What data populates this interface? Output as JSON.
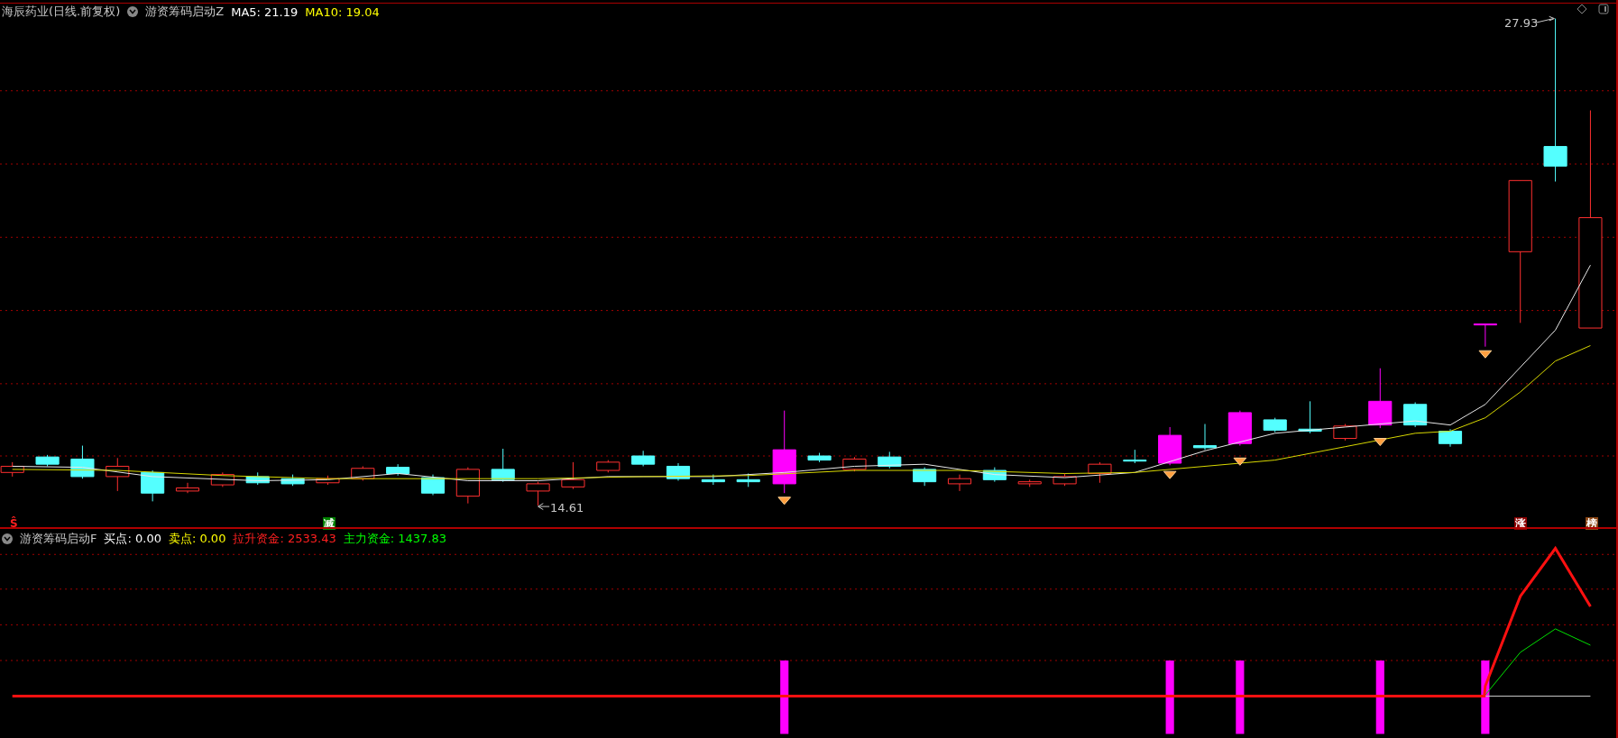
{
  "main_panel": {
    "legend": [
      {
        "text": "海辰药业(日线.前复权)",
        "color": "#c8c8c8"
      },
      {
        "text": "游资筹码启动Z",
        "color": "#c8c8c8"
      },
      {
        "text": "MA5: 21.19",
        "color": "#ffffff"
      },
      {
        "text": "MA10: 19.04",
        "color": "#ffff00"
      }
    ],
    "price_labels": [
      "27.93",
      "14.61"
    ],
    "tags": [
      {
        "text": "Ŝ",
        "color": "#ff2020",
        "kind": "plain"
      },
      {
        "text": "减",
        "color": "#008000",
        "kind": "boxed"
      },
      {
        "text": "涨",
        "color": "#8b0000",
        "kind": "boxed"
      },
      {
        "text": "榜",
        "color": "#8b4513",
        "kind": "boxed"
      }
    ]
  },
  "sub_panel": {
    "legend": [
      {
        "text": "游资筹码启动F",
        "color": "#c8c8c8"
      },
      {
        "text": "买点: 0.00",
        "color": "#ffffff"
      },
      {
        "text": "卖点: 0.00",
        "color": "#ffff00"
      },
      {
        "text": "拉升资金: 2533.43",
        "color": "#ff2020"
      },
      {
        "text": "主力资金: 1437.83",
        "color": "#00ff00"
      }
    ]
  }
}
